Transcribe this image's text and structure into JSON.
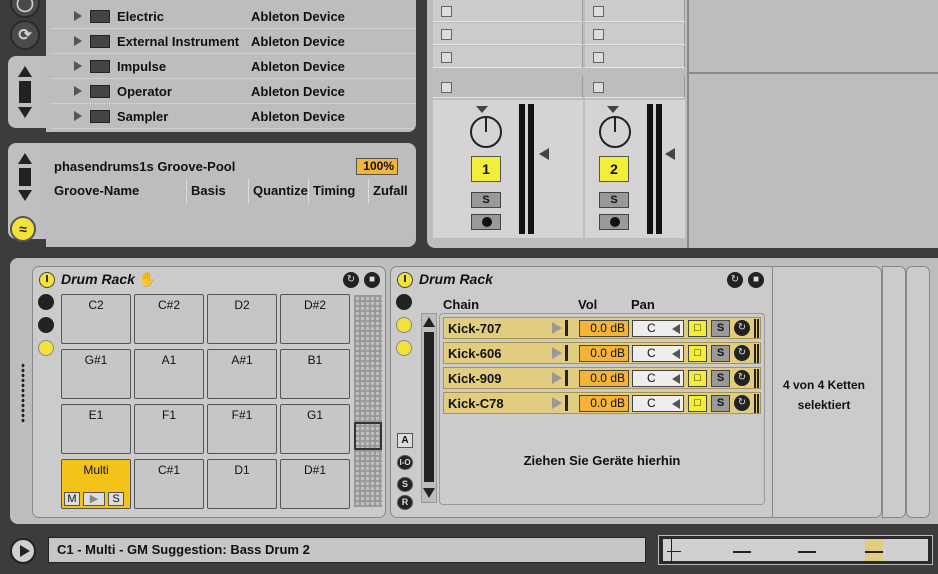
{
  "browser": {
    "rows": [
      {
        "name": "Electric",
        "type": "Ableton Device"
      },
      {
        "name": "External Instrument",
        "type": "Ableton Device"
      },
      {
        "name": "Impulse",
        "type": "Ableton Device"
      },
      {
        "name": "Operator",
        "type": "Ableton Device"
      },
      {
        "name": "Sampler",
        "type": "Ableton Device"
      }
    ]
  },
  "groove_pool": {
    "title": "phasendrums1s Groove-Pool",
    "percent": "100%",
    "columns": [
      "Groove-Name",
      "Basis",
      "Quantize",
      "Timing",
      "Zufall"
    ]
  },
  "mixer": {
    "tracks": [
      {
        "number": "1",
        "solo": "S"
      },
      {
        "number": "2",
        "solo": "S"
      }
    ]
  },
  "drum_rack_pads": {
    "title": "Drum Rack",
    "pads": [
      "C2",
      "C#2",
      "D2",
      "D#2",
      "G#1",
      "A1",
      "A#1",
      "B1",
      "E1",
      "F1",
      "F#1",
      "G1",
      "Multi",
      "C#1",
      "D1",
      "D#1"
    ],
    "selected_pad": "Multi",
    "pad_controls": {
      "mute": "M",
      "solo": "S"
    }
  },
  "drum_rack_chains": {
    "title": "Drum Rack",
    "headers": {
      "chain": "Chain",
      "vol": "Vol",
      "pan": "Pan"
    },
    "chains": [
      {
        "name": "Kick-707",
        "vol": "0.0 dB",
        "pan": "C",
        "solo": "S"
      },
      {
        "name": "Kick-606",
        "vol": "0.0 dB",
        "pan": "C",
        "solo": "S"
      },
      {
        "name": "Kick-909",
        "vol": "0.0 dB",
        "pan": "C",
        "solo": "S"
      },
      {
        "name": "Kick-C78",
        "vol": "0.0 dB",
        "pan": "C",
        "solo": "S"
      }
    ],
    "drop_hint": "Ziehen Sie Geräte hierhin",
    "side_labels": [
      "A",
      "I-O",
      "S",
      "R"
    ]
  },
  "chain_selection_info": "4 von 4 Ketten selektiert",
  "status_bar": {
    "text": "C1 - Multi - GM Suggestion: Bass Drum 2"
  },
  "colors": {
    "panel": "#bdbdbd",
    "background": "#3c3c3c",
    "accent_yellow": "#f2ee3a",
    "accent_orange": "#f4b43a",
    "chain_row": "#e2cc80"
  }
}
